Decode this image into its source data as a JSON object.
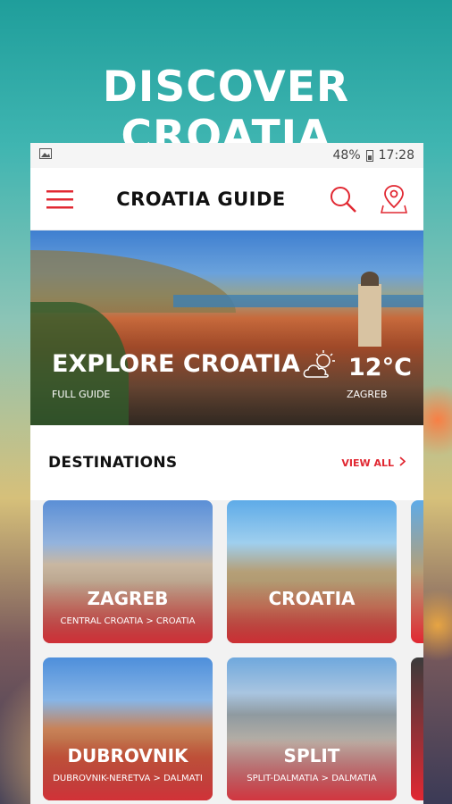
{
  "headline": "DISCOVER CROATIA",
  "status": {
    "battery": "48%",
    "time": "17:28"
  },
  "appbar": {
    "title": "CROATIA GUIDE",
    "menu_icon": "hamburger-menu-icon",
    "search_icon": "search-icon",
    "map_icon": "map-pin-icon"
  },
  "hero": {
    "title": "EXPLORE CROATIA",
    "subtitle": "FULL GUIDE",
    "temperature": "12°C",
    "city": "ZAGREB",
    "weather_icon": "partly-cloudy-icon"
  },
  "destinations": {
    "title": "DESTINATIONS",
    "view_all": "VIEW ALL",
    "items": [
      {
        "name": "ZAGREB",
        "region": "CENTRAL CROATIA > CROATIA"
      },
      {
        "name": "CROATIA",
        "region": ""
      },
      {
        "name": "DUBROVNIK",
        "region": "DUBROVNIK-NERETVA > DALMATI"
      },
      {
        "name": "SPLIT",
        "region": "SPLIT-DALMATIA > DALMATIA"
      }
    ]
  },
  "colors": {
    "accent": "#e12832",
    "title_text": "#111111"
  }
}
